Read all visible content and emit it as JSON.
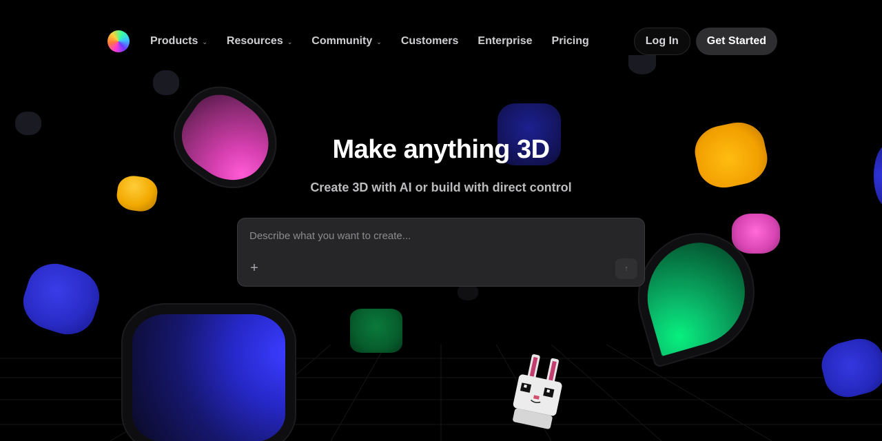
{
  "nav": {
    "logo_icon": "gradient-sphere-logo",
    "items": [
      {
        "label": "Products",
        "has_dropdown": true
      },
      {
        "label": "Resources",
        "has_dropdown": true
      },
      {
        "label": "Community",
        "has_dropdown": true
      },
      {
        "label": "Customers",
        "has_dropdown": false
      },
      {
        "label": "Enterprise",
        "has_dropdown": false
      },
      {
        "label": "Pricing",
        "has_dropdown": false
      }
    ],
    "login_label": "Log In",
    "get_started_label": "Get Started"
  },
  "hero": {
    "title": "Make anything 3D",
    "subtitle": "Create 3D with AI or build with direct control"
  },
  "prompt": {
    "placeholder": "Describe what you want to create...",
    "value": "",
    "add_icon": "plus-icon",
    "send_icon": "arrow-up-icon"
  },
  "colors": {
    "background": "#000000",
    "pink": "#ff5bd6",
    "yellow": "#ffbd10",
    "green": "#08f07f",
    "blue": "#3a3cff",
    "navy": "#1d2090"
  }
}
